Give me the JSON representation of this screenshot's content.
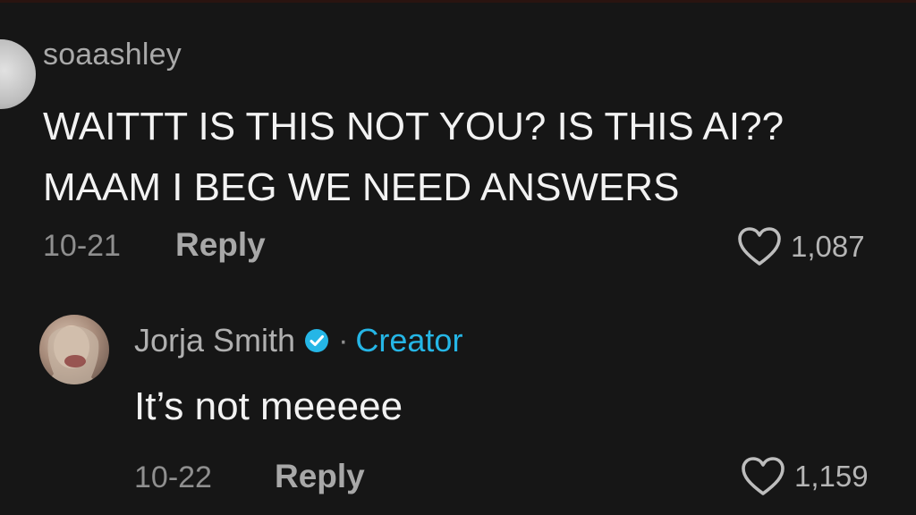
{
  "comments": [
    {
      "username": "soaashley",
      "text_lines": [
        "WAITTT IS THIS NOT YOU? IS THIS AI??",
        "MAAM I BEG WE NEED ANSWERS"
      ],
      "date": "10-21",
      "reply_label": "Reply",
      "likes": "1,087",
      "like_icon": "heart-outline-icon",
      "avatar_icon": "avatar"
    },
    {
      "username": "Jorja Smith",
      "verified_icon": "verified-badge-icon",
      "separator": "·",
      "role": "Creator",
      "text": "It’s not meeeee",
      "date": "10-22",
      "reply_label": "Reply",
      "likes": "1,159",
      "like_icon": "heart-outline-icon",
      "avatar_icon": "avatar"
    }
  ],
  "colors": {
    "background": "#161616",
    "creator_accent": "#25b6e6",
    "verified_badge": "#25b6e6",
    "primary_text": "#f2f2f2",
    "secondary_text": "#a9a9a9"
  }
}
